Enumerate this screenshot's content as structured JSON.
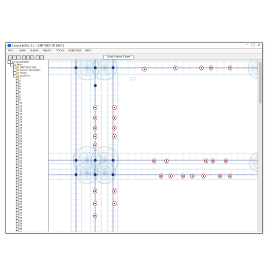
{
  "window": {
    "title": "LayoutEditor 4.1 - SMP WDT 06 [H01]",
    "controls": {
      "minimize": "—",
      "maximize": "□",
      "close": "×"
    }
  },
  "menu": [
    "FILE",
    "VIEW",
    "SHAPE",
    "IMAGE",
    "TOOLS",
    "WINDOWS",
    "HELP"
  ],
  "toolbar": {
    "document_tab": "Quad_frame_Fused"
  },
  "tree": {
    "items": [
      {
        "label": "LayoutEditor",
        "level": 0,
        "kind": "folder"
      },
      {
        "label": "WDT",
        "level": 1,
        "kind": "folder"
      },
      {
        "label": "SMP WDT 06D",
        "level": 2,
        "kind": "folder"
      },
      {
        "label": "Source Templates",
        "level": 2,
        "kind": "folder"
      },
      {
        "label": "Fluids",
        "level": 2,
        "kind": "folder"
      },
      {
        "label": "Sections",
        "level": 2,
        "kind": "folder"
      },
      {
        "label": "1",
        "level": 3,
        "kind": "doc"
      },
      {
        "label": "2",
        "level": 3,
        "kind": "doc"
      },
      {
        "label": "3",
        "level": 3,
        "kind": "doc"
      },
      {
        "label": "4",
        "level": 3,
        "kind": "doc"
      },
      {
        "label": "5",
        "level": 3,
        "kind": "doc"
      },
      {
        "label": "6",
        "level": 3,
        "kind": "doc"
      },
      {
        "label": "7",
        "level": 3,
        "kind": "doc"
      },
      {
        "label": "8",
        "level": 3,
        "kind": "doc"
      },
      {
        "label": "9",
        "level": 3,
        "kind": "doc"
      },
      {
        "label": "10",
        "level": 3,
        "kind": "doc"
      },
      {
        "label": "11",
        "level": 3,
        "kind": "doc"
      },
      {
        "label": "12",
        "level": 3,
        "kind": "doc"
      },
      {
        "label": "13",
        "level": 3,
        "kind": "doc"
      },
      {
        "label": "14",
        "level": 3,
        "kind": "doc"
      },
      {
        "label": "15",
        "level": 3,
        "kind": "doc"
      },
      {
        "label": "16",
        "level": 3,
        "kind": "doc"
      },
      {
        "label": "17",
        "level": 3,
        "kind": "doc"
      },
      {
        "label": "18",
        "level": 3,
        "kind": "doc"
      },
      {
        "label": "19",
        "level": 3,
        "kind": "doc"
      },
      {
        "label": "20",
        "level": 3,
        "kind": "doc"
      },
      {
        "label": "21",
        "level": 3,
        "kind": "doc"
      },
      {
        "label": "22",
        "level": 3,
        "kind": "doc"
      },
      {
        "label": "23",
        "level": 3,
        "kind": "doc"
      },
      {
        "label": "24",
        "level": 3,
        "kind": "doc"
      },
      {
        "label": "25",
        "level": 3,
        "kind": "doc"
      },
      {
        "label": "26",
        "level": 3,
        "kind": "doc"
      },
      {
        "label": "27",
        "level": 3,
        "kind": "doc"
      },
      {
        "label": "28",
        "level": 3,
        "kind": "doc"
      },
      {
        "label": "29",
        "level": 3,
        "kind": "doc"
      },
      {
        "label": "30",
        "level": 3,
        "kind": "doc"
      },
      {
        "label": "31",
        "level": 3,
        "kind": "doc"
      },
      {
        "label": "32",
        "level": 3,
        "kind": "doc"
      },
      {
        "label": "33",
        "level": 3,
        "kind": "doc"
      },
      {
        "label": "34",
        "level": 3,
        "kind": "doc"
      },
      {
        "label": "35",
        "level": 3,
        "kind": "doc"
      },
      {
        "label": "36",
        "level": 3,
        "kind": "doc"
      },
      {
        "label": "37",
        "level": 3,
        "kind": "doc"
      },
      {
        "label": "38",
        "level": 3,
        "kind": "doc"
      },
      {
        "label": "39",
        "level": 3,
        "kind": "doc"
      },
      {
        "label": "40",
        "level": 3,
        "kind": "doc"
      },
      {
        "label": "41",
        "level": 3,
        "kind": "doc"
      },
      {
        "label": "42",
        "level": 3,
        "kind": "doc"
      },
      {
        "label": "43",
        "level": 3,
        "kind": "doc"
      },
      {
        "label": "44",
        "level": 3,
        "kind": "doc"
      },
      {
        "label": "45",
        "level": 3,
        "kind": "doc"
      },
      {
        "label": "46",
        "level": 3,
        "kind": "doc"
      },
      {
        "label": "47",
        "level": 3,
        "kind": "doc"
      },
      {
        "label": "48",
        "level": 3,
        "kind": "doc"
      },
      {
        "label": "49",
        "level": 3,
        "kind": "doc"
      },
      {
        "label": "50",
        "level": 3,
        "kind": "doc"
      },
      {
        "label": "51",
        "level": 3,
        "kind": "doc"
      },
      {
        "label": "52",
        "level": 3,
        "kind": "doc"
      },
      {
        "label": "53",
        "level": 3,
        "kind": "doc"
      },
      {
        "label": "54",
        "level": 3,
        "kind": "doc"
      },
      {
        "label": "55",
        "level": 3,
        "kind": "doc"
      },
      {
        "label": "56",
        "level": 3,
        "kind": "doc"
      },
      {
        "label": "57",
        "level": 3,
        "kind": "doc"
      },
      {
        "label": "58",
        "level": 3,
        "kind": "doc"
      }
    ]
  },
  "colors": {
    "trace": "#a9cde0",
    "trace_dark": "#7fb2cc",
    "bus": "#2b3f8f",
    "electrode": "#c0392b",
    "electrode_core": "#1c2a6b",
    "node": "#1f3a93"
  }
}
